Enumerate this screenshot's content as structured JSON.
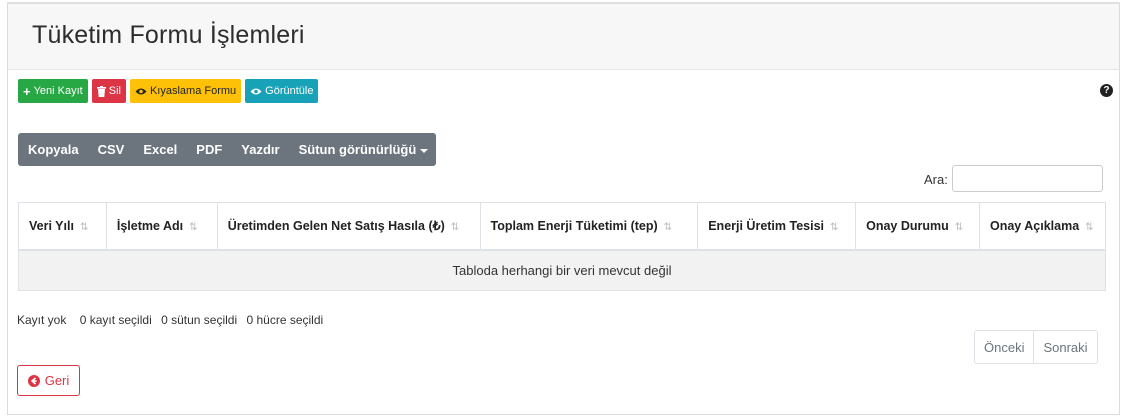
{
  "header": {
    "title": "Tüketim Formu İşlemleri"
  },
  "toolbar": {
    "new_label": "Yeni Kayıt",
    "delete_label": "Sil",
    "compare_label": "Kıyaslama Formu",
    "view_label": "Görüntüle",
    "help_icon": "question-circle-icon"
  },
  "export": {
    "copy": "Kopyala",
    "csv": "CSV",
    "excel": "Excel",
    "pdf": "PDF",
    "print": "Yazdır",
    "columns": "Sütun görünürlüğü"
  },
  "search": {
    "label": "Ara:",
    "value": ""
  },
  "table": {
    "columns": [
      "Veri Yılı",
      "İşletme Adı",
      "Üretimden Gelen Net Satış Hasıla (₺)",
      "Toplam Enerji Tüketimi (tep)",
      "Enerji Üretim Tesisi",
      "Onay Durumu",
      "Onay Açıklama"
    ],
    "empty_message": "Tabloda herhangi bir veri mevcut değil"
  },
  "info": {
    "records": "Kayıt yok",
    "selected_rows": "0 kayıt seçildi",
    "selected_cols": "0 sütun seçildi",
    "selected_cells": "0 hücre seçildi"
  },
  "pagination": {
    "prev": "Önceki",
    "next": "Sonraki"
  },
  "back": {
    "label": "Geri"
  },
  "colors": {
    "green": "#28a745",
    "red": "#dc3545",
    "yellow": "#ffc107",
    "cyan": "#17a2b8",
    "gray": "#6c757d"
  }
}
